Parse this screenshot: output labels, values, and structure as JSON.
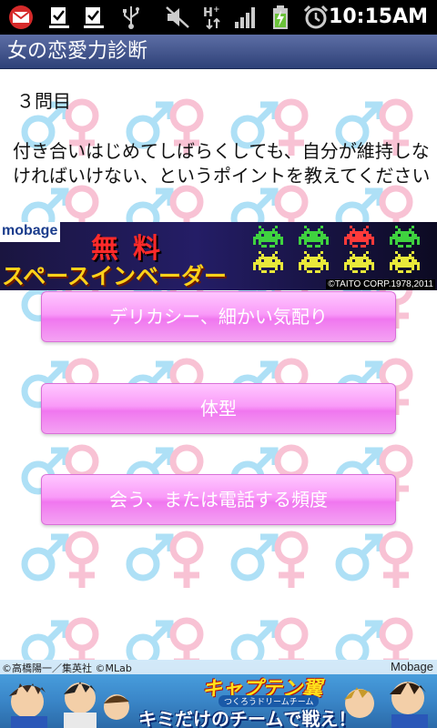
{
  "status_bar": {
    "time": "10:15AM",
    "icons": [
      "gmail-icon",
      "download-done-icon",
      "download-done-icon",
      "usb-icon",
      "mute-icon",
      "data-hplus-icon",
      "signal-icon",
      "battery-charging-icon",
      "alarm-icon"
    ]
  },
  "app": {
    "title": "女の恋愛力診断"
  },
  "question": {
    "number": "３問目",
    "text": "付き合いはじめてしばらくしても、自分が維持しなければいけない、というポイントを教えてください"
  },
  "answers": [
    {
      "label": "デリカシー、細かい気配り"
    },
    {
      "label": "体型"
    },
    {
      "label": "会う、または電話する頻度"
    }
  ],
  "ads": {
    "top": {
      "brand": "mobage",
      "free_label": "無料",
      "title": "スペースインベーダー",
      "copyright": "©TAITO CORP.1978,2011"
    },
    "bottom": {
      "credit": "©高橋陽一／集英社 ©MLab",
      "brand": "Mobage",
      "logo": "キャプテン翼",
      "sublogo": "つくろうドリームチーム",
      "slogan": "キミだけのチームで戦え！"
    }
  },
  "colors": {
    "male_symbol": "#aee0f6",
    "female_symbol": "#f8c2d4",
    "button_top": "#ffc7ff",
    "button_bottom": "#f077ef",
    "titlebar": "#3c4f88"
  }
}
